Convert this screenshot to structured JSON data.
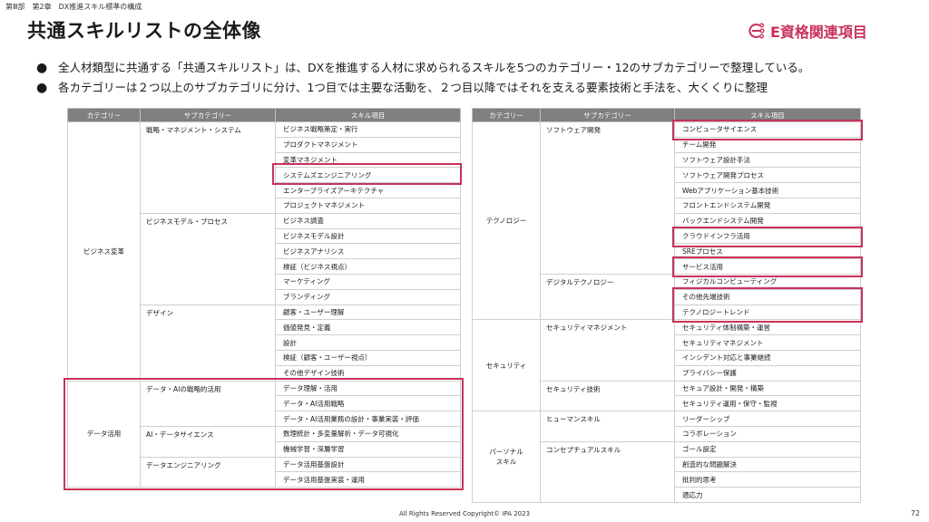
{
  "breadcrumb": "第Ⅲ部　第2章　DX推進スキル標準の構成",
  "title": "共通スキルリストの全体像",
  "badge": {
    "label": "E資格関連項目",
    "color": "#c8325a",
    "icon": "e-circuit-icon"
  },
  "bullets": [
    "全人材類型に共通する「共通スキルリスト」は、DXを推進する人材に求められるスキルを5つのカテゴリー・12のサブカテゴリーで整理している。",
    "各カテゴリーは２つ以上のサブカテゴリに分け、1つ目では主要な活動を、２つ目以降ではそれを支える要素技術と手法を、大くくりに整理"
  ],
  "table_headers": [
    "カテゴリー",
    "サブカテゴリー",
    "スキル項目"
  ],
  "left_table": [
    {
      "category": "ビジネス変革",
      "subcategories": [
        {
          "name": "戦略・マネジメント・システム",
          "skills": [
            "ビジネス戦略策定・実行",
            "プロダクトマネジメント",
            "変革マネジメント",
            "システムズエンジニアリング",
            "エンタープライズアーキテクチャ",
            "プロジェクトマネジメント"
          ]
        },
        {
          "name": "ビジネスモデル・プロセス",
          "skills": [
            "ビジネス調査",
            "ビジネスモデル設計",
            "ビジネスアナリシス",
            "検証（ビジネス視点）",
            "マーケティング",
            "ブランディング"
          ]
        },
        {
          "name": "デザイン",
          "skills": [
            "顧客・ユーザー理解",
            "価値発見・定義",
            "設計",
            "検証（顧客・ユーザー視点）",
            "その他デザイン技術"
          ]
        }
      ]
    },
    {
      "category": "データ活用",
      "subcategories": [
        {
          "name": "データ・AIの戦略的活用",
          "skills": [
            "データ理解・活用",
            "データ・AI活用戦略",
            "データ・AI活用業務の設計・事業実装・評価"
          ]
        },
        {
          "name": "AI・データサイエンス",
          "skills": [
            "数理統計・多変量解析・データ可視化",
            "機械学習・深層学習"
          ]
        },
        {
          "name": "データエンジニアリング",
          "skills": [
            "データ活用基盤設計",
            "データ活用基盤実装・運用"
          ]
        }
      ]
    }
  ],
  "right_table": [
    {
      "category": "テクノロジー",
      "subcategories": [
        {
          "name": "ソフトウェア開発",
          "skills": [
            "コンピュータサイエンス",
            "チーム開発",
            "ソフトウェア設計手法",
            "ソフトウェア開発プロセス",
            "Webアプリケーション基本技術",
            "フロントエンドシステム開発",
            "バックエンドシステム開発",
            "クラウドインフラ活用",
            "SREプロセス",
            "サービス活用"
          ]
        },
        {
          "name": "デジタルテクノロジー",
          "skills": [
            "フィジカルコンピューティング",
            "その他先端技術",
            "テクノロジートレンド"
          ]
        }
      ]
    },
    {
      "category": "セキュリティ",
      "subcategories": [
        {
          "name": "セキュリティマネジメント",
          "skills": [
            "セキュリティ体制構築・運営",
            "セキュリティマネジメント",
            "インシデント対応と事業継続",
            "プライバシー保護"
          ]
        },
        {
          "name": "セキュリティ技術",
          "skills": [
            "セキュア設計・開発・構築",
            "セキュリティ運用・保守・監視"
          ]
        }
      ]
    },
    {
      "category": "パーソナル\nスキル",
      "subcategories": [
        {
          "name": "ヒューマンスキル",
          "skills": [
            "リーダーシップ",
            "コラボレーション"
          ]
        },
        {
          "name": "コンセプチュアルスキル",
          "skills": [
            "ゴール設定",
            "創造的な問題解決",
            "批判的思考",
            "適応力"
          ]
        }
      ]
    }
  ],
  "footer": "All Rights Reserved Copyright© IPA 2023",
  "page_number": "72"
}
